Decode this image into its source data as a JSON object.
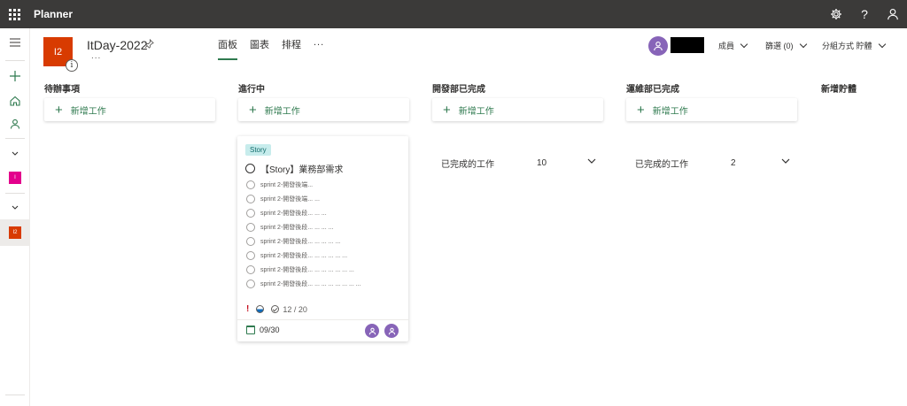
{
  "app": {
    "title": "Planner"
  },
  "plan": {
    "logo_text": "I2",
    "title": "ItDay-2022",
    "more": "...",
    "info": "i"
  },
  "tabs": [
    {
      "label": "面板",
      "active": true
    },
    {
      "label": "圖表",
      "active": false
    },
    {
      "label": "排程",
      "active": false
    }
  ],
  "tab_more": "...",
  "header": {
    "members_label": "成員",
    "filter_label": "篩選 (0)",
    "group_by_label": "分組方式 貯體"
  },
  "rail": {
    "plan_items": [
      {
        "text": "I",
        "color": "#e3008c"
      },
      {
        "text": "I2",
        "color": "#d83b01"
      }
    ]
  },
  "columns": [
    {
      "title": "待辦事項",
      "add_label": "新增工作"
    },
    {
      "title": "進行中",
      "add_label": "新增工作"
    },
    {
      "title": "開發部已完成",
      "add_label": "新增工作",
      "completed_label": "已完成的工作",
      "completed_count": "10"
    },
    {
      "title": "運維部已完成",
      "add_label": "新增工作",
      "completed_label": "已完成的工作",
      "completed_count": "2"
    },
    {
      "title": "新增貯體"
    }
  ],
  "task": {
    "label": "Story",
    "title": "【Story】業務部需求",
    "checklist": [
      "sprint 2-開發後端...",
      "sprint 2-開發後端... ...",
      "sprint 2-開發後段... ... ...",
      "sprint 2-開發後段... ... ... ...",
      "sprint 2-開發後段... ... ... ... ...",
      "sprint 2-開發後段... ... ... ... ... ...",
      "sprint 2-開發後段... ... ... ... ... ... ...",
      "sprint 2-開發後段... ... ... ... ... ... ... ..."
    ],
    "urgent": "!",
    "checklist_progress": "12 / 20",
    "due": "09/30"
  },
  "colors": {
    "accent": "#2f7a4f",
    "avatar": "#8764b8",
    "plan_logo": "#d83b01",
    "appbar": "#3b3a39"
  }
}
